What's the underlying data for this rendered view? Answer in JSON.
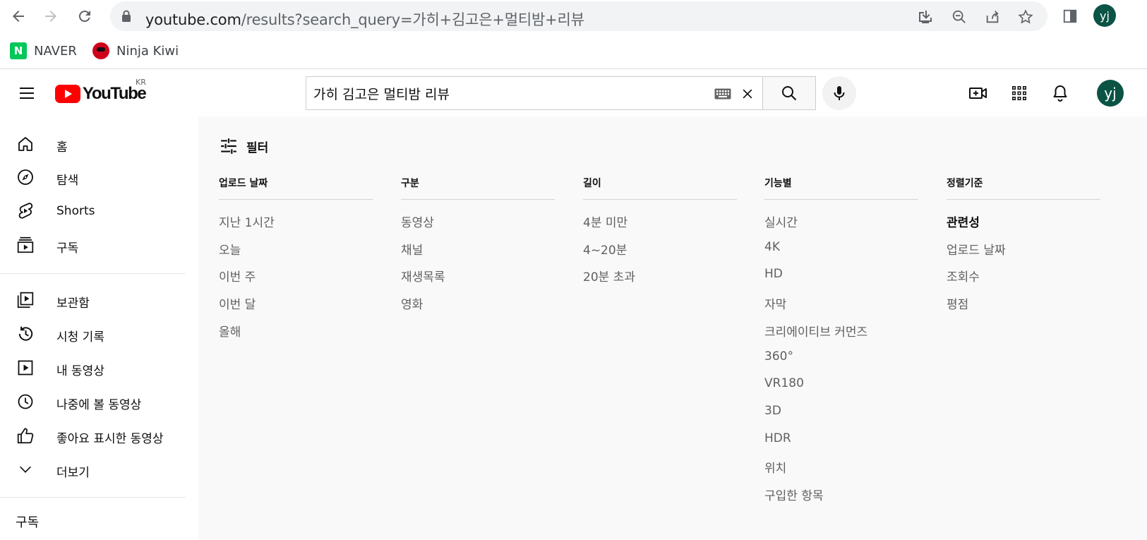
{
  "browser": {
    "url_host": "youtube.com",
    "url_path": "/results?search_query=가히+김고은+멀티밤+리뷰",
    "profile_initials": "yj",
    "bookmarks": [
      {
        "label": "NAVER",
        "icon": "naver-logo",
        "logo_letter": "N"
      },
      {
        "label": "Ninja Kiwi",
        "icon": "ninja-kiwi-logo"
      }
    ]
  },
  "masthead": {
    "logo_text": "YouTube",
    "country_code": "KR",
    "search_value": "가히 김고은 멀티밤 리뷰",
    "avatar_initials": "yj"
  },
  "sidebar": {
    "primary": [
      {
        "label": "홈",
        "icon": "home-icon"
      },
      {
        "label": "탐색",
        "icon": "compass-icon"
      },
      {
        "label": "Shorts",
        "icon": "shorts-icon"
      },
      {
        "label": "구독",
        "icon": "subscriptions-icon"
      }
    ],
    "library": [
      {
        "label": "보관함",
        "icon": "library-icon"
      },
      {
        "label": "시청 기록",
        "icon": "history-icon"
      },
      {
        "label": "내 동영상",
        "icon": "my-videos-icon"
      },
      {
        "label": "나중에 볼 동영상",
        "icon": "watch-later-icon"
      },
      {
        "label": "좋아요 표시한 동영상",
        "icon": "thumbs-up-icon"
      },
      {
        "label": "더보기",
        "icon": "chevron-down-icon"
      }
    ],
    "subscriptions_heading": "구독"
  },
  "filters": {
    "title": "필터",
    "columns": [
      {
        "title": "업로드 날짜",
        "options": [
          "지난 1시간",
          "오늘",
          "이번 주",
          "이번 달",
          "올해"
        ],
        "active": -1
      },
      {
        "title": "구분",
        "options": [
          "동영상",
          "채널",
          "재생목록",
          "영화"
        ],
        "active": -1
      },
      {
        "title": "길이",
        "options": [
          "4분 미만",
          "4~20분",
          "20분 초과"
        ],
        "active": -1
      },
      {
        "title": "기능별",
        "options": [
          "실시간",
          "4K",
          "HD",
          "자막",
          "크리에이티브 커먼즈",
          "360°",
          "VR180",
          "3D",
          "HDR",
          "위치",
          "구입한 항목"
        ],
        "active": -1
      },
      {
        "title": "정렬기준",
        "options": [
          "관련성",
          "업로드 날짜",
          "조회수",
          "평점"
        ],
        "active": 0
      }
    ]
  }
}
